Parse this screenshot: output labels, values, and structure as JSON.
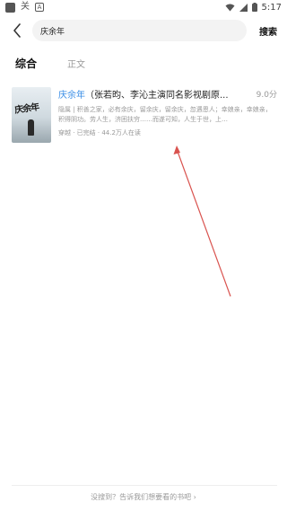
{
  "status_bar": {
    "time": "5:17",
    "icons": [
      "app-square-icon",
      "app-glyph-icon",
      "notification-a-icon",
      "wifi-icon",
      "signal-icon",
      "battery-icon"
    ],
    "glyph_text": "关",
    "box_text": "A"
  },
  "search": {
    "query": "庆余年",
    "button_label": "搜索"
  },
  "tabs": [
    {
      "label": "综合",
      "active": true
    },
    {
      "label": "正文",
      "active": false
    }
  ],
  "result": {
    "title_highlight": "庆余年",
    "title_rest": "（张若昀、李沁主演同名影视剧原...",
    "score": "9.0分",
    "description": "隐属 | 积善之家，必有余庆，留余庆，留余庆，忽遇恩人；幸娘亲，幸娘亲，积得阴功。劳人生，济困扶穷……而遂可知，人生于世，上…",
    "meta": "穿越 · 已完结 · 44.2万人在读",
    "cover_text": "庆余年"
  },
  "annotation": {
    "color": "#d9534f"
  },
  "footer": {
    "link_text": "没搜到？告诉我们想要看的书吧 ›"
  }
}
